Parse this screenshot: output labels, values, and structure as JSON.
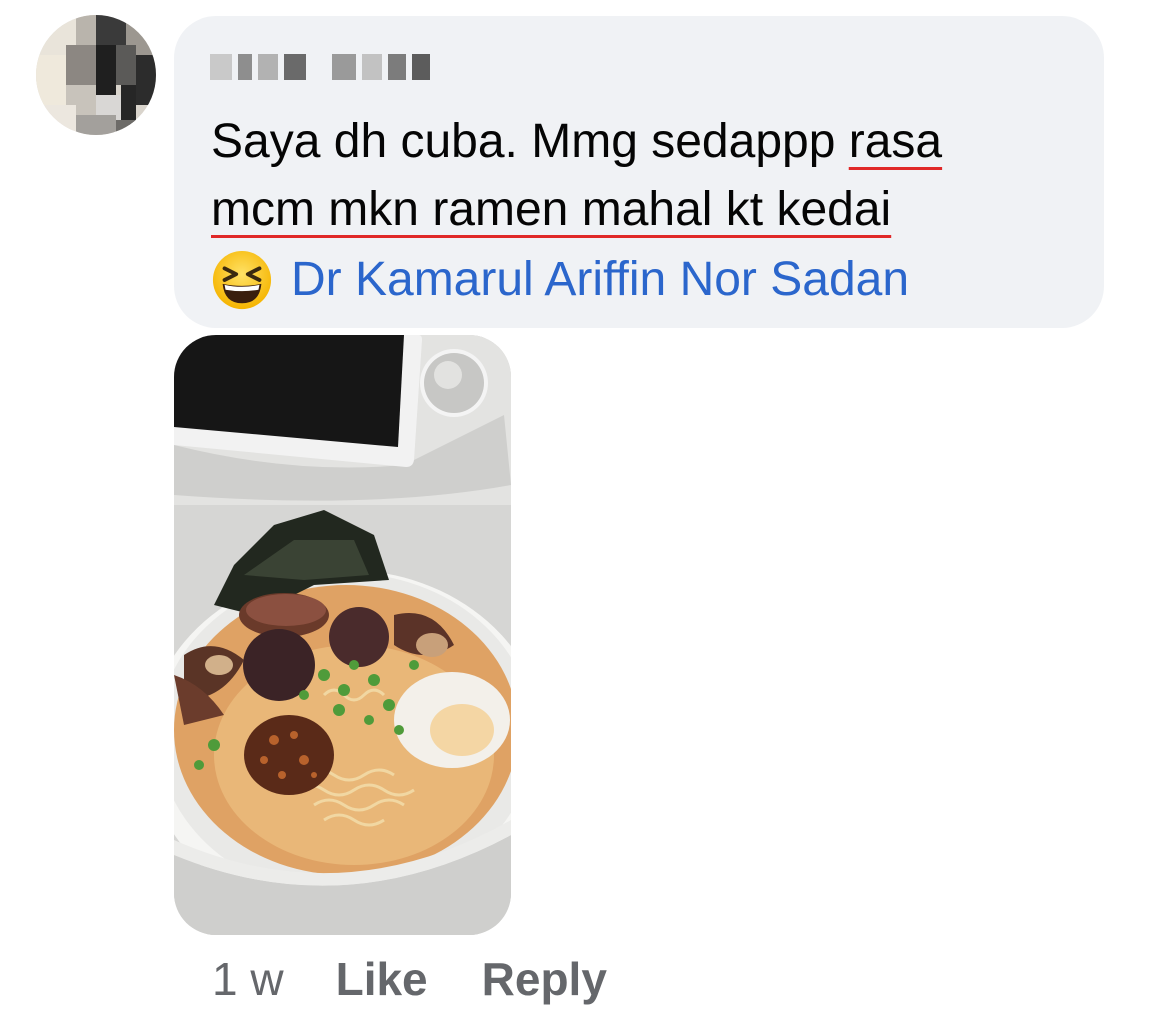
{
  "comment": {
    "line1_main": "Saya dh cuba. Mmg sedappp ",
    "line1_spell": "rasa",
    "line2_spell": "mcm mkn ramen mahal kt kedai",
    "mention": "Dr Kamarul Ariffin Nor Sadan",
    "emoji": "grinning-squinting-face-emoji"
  },
  "actions": {
    "time": "1 w",
    "like": "Like",
    "reply": "Reply"
  },
  "colors": {
    "bubble": "#f0f2f5",
    "mention": "#2b66cc",
    "spellcheck": "#e02828",
    "meta": "#65676b"
  }
}
